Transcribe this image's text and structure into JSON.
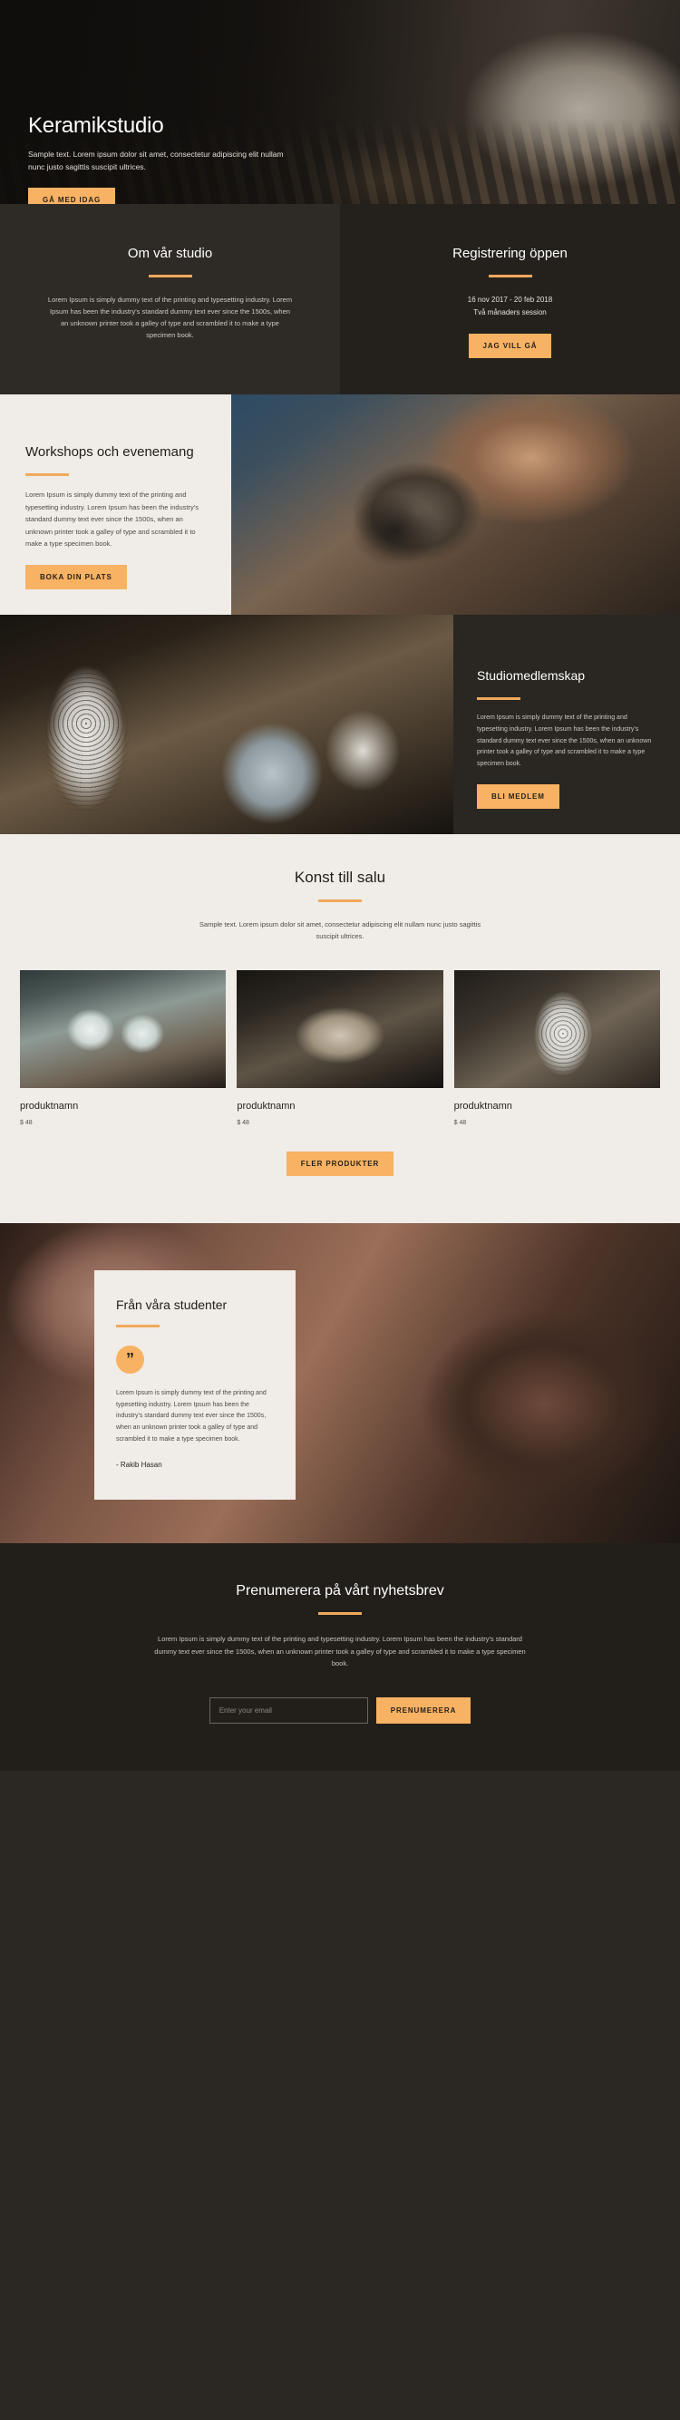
{
  "hero": {
    "title": "Keramikstudio",
    "subtitle": "Sample text. Lorem ipsum dolor sit amet, consectetur adipiscing elit nullam nunc justo sagittis suscipit ultrices.",
    "cta_label": "GÅ MED IDAG"
  },
  "about": {
    "title": "Om vår studio",
    "body": "Lorem Ipsum is simply dummy text of the printing and typesetting industry. Lorem Ipsum has been the industry's standard dummy text ever since the 1500s, when an unknown printer took a galley of type and scrambled it to make a type specimen book."
  },
  "registration": {
    "title": "Registrering öppen",
    "dates": "16 nov 2017 - 20 feb 2018",
    "session": "Två månaders session",
    "cta_label": "JAG VILL GÅ"
  },
  "workshops": {
    "title": "Workshops och evenemang",
    "body": "Lorem Ipsum is simply dummy text of the printing and typesetting industry. Lorem Ipsum has been the industry's standard dummy text ever since the 1500s, when an unknown printer took a galley of type and scrambled it to make a type specimen book.",
    "cta_label": "BOKA DIN PLATS"
  },
  "membership": {
    "title": "Studiomedlemskap",
    "body": "Lorem Ipsum is simply dummy text of the printing and typesetting industry. Lorem Ipsum has been the industry's standard dummy text ever since the 1500s, when an unknown printer took a galley of type and scrambled it to make a type specimen book.",
    "cta_label": "BLI MEDLEM"
  },
  "shop": {
    "title": "Konst till salu",
    "intro": "Sample text. Lorem ipsum dolor sit amet, consectetur adipiscing elit nullam nunc justo sagittis suscipit ultrices.",
    "products": [
      {
        "name": "produktnamn",
        "price": "$ 48"
      },
      {
        "name": "produktnamn",
        "price": "$ 48"
      },
      {
        "name": "produktnamn",
        "price": "$ 48"
      }
    ],
    "more_label": "FLER PRODUKTER"
  },
  "testimonial": {
    "title": "Från våra studenter",
    "quote_icon": "quote-mark",
    "quote_glyph": "”",
    "body": "Lorem Ipsum is simply dummy text of the printing and typesetting industry. Lorem Ipsum has been the industry's standard dummy text ever since the 1500s, when an unknown printer took a galley of type and scrambled it to make a type specimen book.",
    "author": "- Rakib Hasan"
  },
  "newsletter": {
    "title": "Prenumerera på vårt nyhetsbrev",
    "body": "Lorem Ipsum is simply dummy text of the printing and typesetting industry. Lorem Ipsum has been the industry's standard dummy text ever since the 1500s, when an unknown printer took a galley of type and scrambled it to make a type specimen book.",
    "email_placeholder": "Enter your email",
    "email_value": "",
    "cta_label": "PRENUMERERA"
  },
  "colors": {
    "accent": "#f8b263",
    "rule": "#f0a95c",
    "dark_bg": "#2a2621",
    "light_bg": "#f0ece7"
  }
}
